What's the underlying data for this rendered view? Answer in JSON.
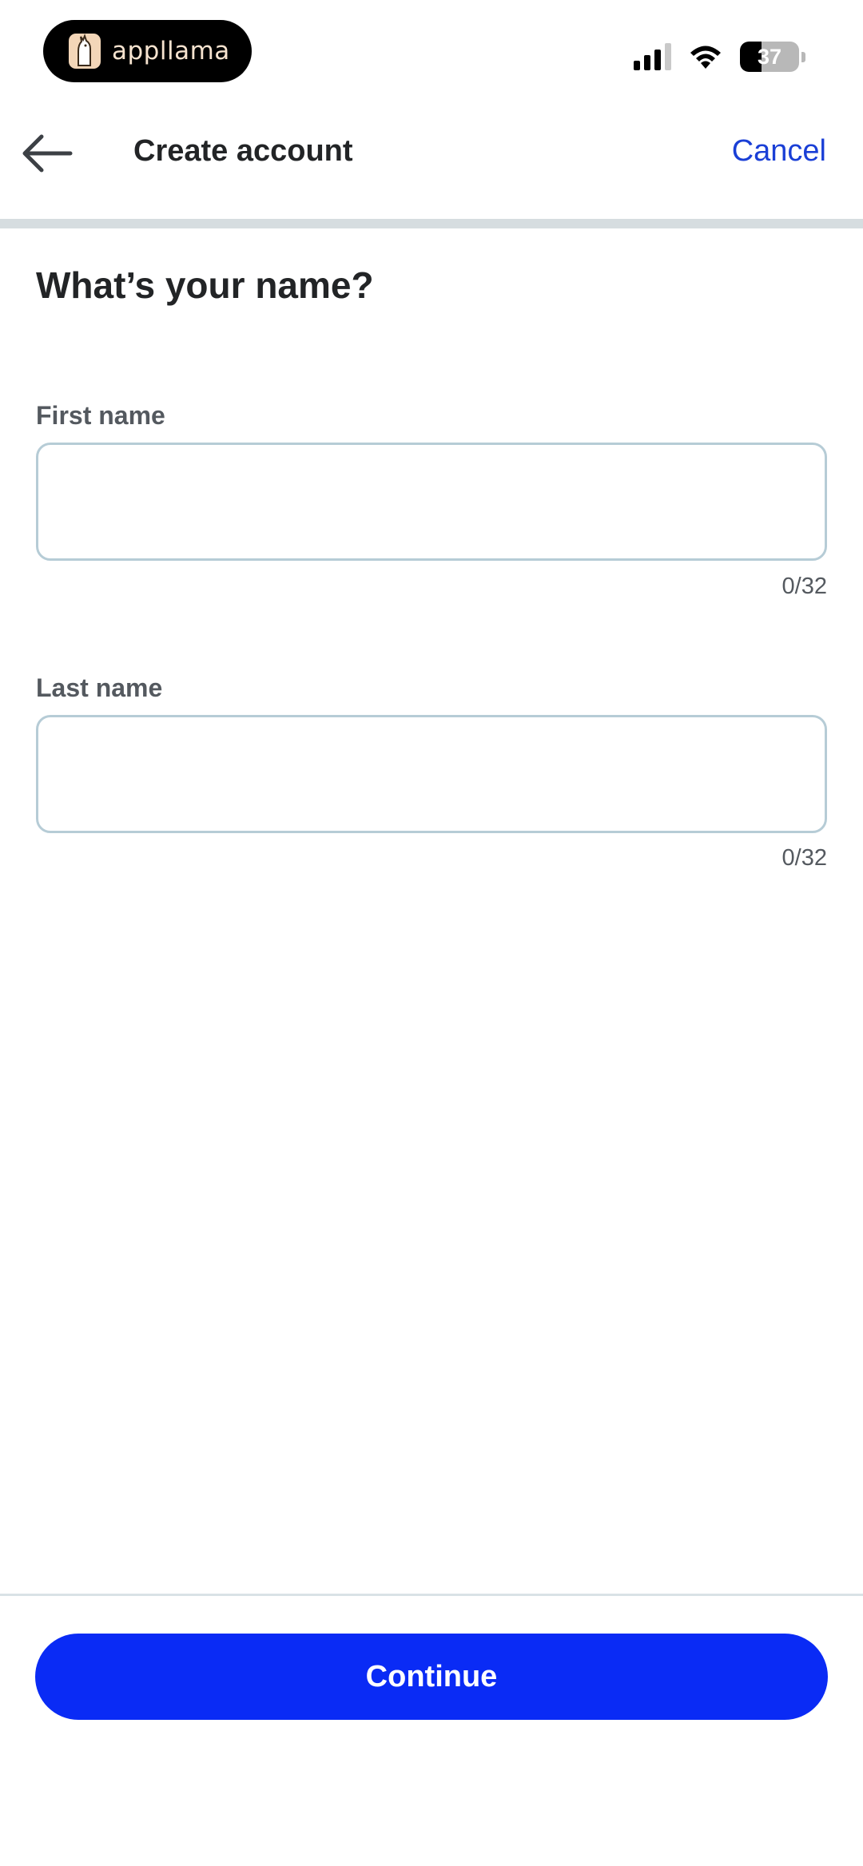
{
  "status_bar": {
    "app_pill_label": "appllama",
    "battery_level": "37",
    "battery_fraction": 0.37,
    "signal_bars_active": 3,
    "signal_bars_total": 4,
    "icons": [
      "signal-icon",
      "wifi-icon",
      "battery-icon"
    ]
  },
  "header": {
    "title": "Create account",
    "cancel_label": "Cancel",
    "back_icon": "arrow-left-icon",
    "progress_fraction": 0.0
  },
  "form": {
    "question": "What’s your name?",
    "first_name": {
      "label": "First name",
      "value": "",
      "placeholder": "",
      "counter": "0/32"
    },
    "last_name": {
      "label": "Last name",
      "value": "",
      "placeholder": "",
      "counter": "0/32"
    }
  },
  "footer": {
    "continue_label": "Continue"
  },
  "colors": {
    "accent": "#0a2bf5",
    "link": "#1a3fd6",
    "input_border": "#b6ccd6",
    "text_primary": "#222426",
    "text_secondary": "#54595f"
  }
}
